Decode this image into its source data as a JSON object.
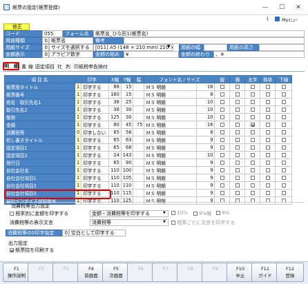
{
  "window": {
    "title": "帳票の設定(帳票登録)",
    "min": "—",
    "max": "☐",
    "close": "✕",
    "menu": "⁞",
    "user": "Myﾒﾆｭｰ"
  },
  "status_badge": "修正",
  "header": {
    "code_label": "コード",
    "code_value": "055",
    "form_label": "フォーム名",
    "form_value": "帳票名_ひな形1(帳票名)",
    "use_label": "用途種類",
    "use_num": "0",
    "use_value": "帳票名",
    "comment_label": "備考",
    "paper_label": "用紙サイズ",
    "paper_num": "0",
    "paper_value": "サイズを選択する",
    "paper_select": "[011] A5 (148 × 210 mm) 210 × 1",
    "width_label": "用紙の幅",
    "height_label": "用紙の高さ",
    "amount_label": "金額表示",
    "amount_num": "0",
    "amount_value": "アラビア数字",
    "amount_start_label": "金額の始め",
    "amount_start_value": "¥",
    "amount_end_label": "金額の終わり",
    "amount_end_value": "、※"
  },
  "tabs": [
    "明　細",
    "書",
    "線",
    "固定項目",
    "社",
    "判",
    "印紙税申告納付"
  ],
  "grid_headers": [
    "項 目 名",
    "印字",
    "X軸",
    "Y軸",
    "幅",
    "フォント名 / サイズ",
    "縦",
    "横",
    "太字",
    "斜体",
    "下線"
  ],
  "rows": [
    {
      "name": "帳票用タイトル",
      "p": "1",
      "pl": "印字する",
      "x": "88",
      "y": "15",
      "w": "",
      "font": "ＭＳ 明朝",
      "size": "16",
      "c": [
        0,
        0,
        0,
        0,
        0
      ]
    },
    {
      "name": "帳票番号",
      "p": "1",
      "pl": "印字する",
      "x": "160",
      "y": "15",
      "w": "",
      "font": "ＭＳ 明朝",
      "size": "8",
      "c": [
        0,
        0,
        0,
        0,
        0
      ]
    },
    {
      "name": "宛名　取引先名1",
      "p": "1",
      "pl": "印字する",
      "x": "38",
      "y": "25",
      "w": "",
      "font": "ＭＳ 明朝",
      "size": "10",
      "c": [
        0,
        0,
        0,
        0,
        0
      ]
    },
    {
      "name": "取引先名2",
      "p": "1",
      "pl": "印字する",
      "x": "38",
      "y": "30",
      "w": "",
      "font": "ＭＳ 明朝",
      "size": "10",
      "c": [
        0,
        0,
        0,
        0,
        0
      ]
    },
    {
      "name": "敬称",
      "p": "1",
      "pl": "印字する",
      "x": "125",
      "y": "30",
      "w": "",
      "font": "ＭＳ 明朝",
      "size": "10",
      "c": [
        0,
        0,
        0,
        0,
        0
      ]
    },
    {
      "name": "金額",
      "p": "1",
      "pl": "印字する",
      "x": "80",
      "y": "45",
      "w": "75",
      "font": "ＭＳ 明朝",
      "size": "16",
      "c": [
        0,
        0,
        1,
        0,
        0
      ]
    },
    {
      "name": "消費税等",
      "p": "0",
      "pl": "印字しない",
      "x": "65",
      "y": "58",
      "w": "",
      "font": "ＭＳ 明朝",
      "size": "8",
      "c": [
        0,
        0,
        0,
        0,
        0
      ]
    },
    {
      "name": "但し書きタイトル",
      "p": "1",
      "pl": "印字する",
      "x": "65",
      "y": "63",
      "w": "",
      "font": "ＭＳ 明朝",
      "size": "9",
      "c": [
        0,
        0,
        0,
        0,
        0
      ]
    },
    {
      "name": "固定項目1",
      "p": "1",
      "pl": "印字する",
      "x": "65",
      "y": "68",
      "w": "",
      "font": "ＭＳ 明朝",
      "size": "9",
      "c": [
        0,
        0,
        0,
        0,
        0
      ]
    },
    {
      "name": "固定項目2",
      "p": "1",
      "pl": "印字する",
      "x": "24",
      "y": "143",
      "w": "",
      "font": "ＭＳ 明朝",
      "size": "10",
      "c": [
        0,
        0,
        0,
        0,
        0
      ]
    },
    {
      "name": "発行日",
      "p": "1",
      "pl": "印字する",
      "x": "65",
      "y": "90",
      "w": "",
      "font": "ＭＳ 明朝",
      "size": "9",
      "c": [
        0,
        0,
        0,
        0,
        0
      ]
    },
    {
      "name": "自社会社名",
      "p": "1",
      "pl": "印字する",
      "x": "110",
      "y": "100",
      "w": "",
      "font": "ＭＳ 明朝",
      "size": "9",
      "c": [
        0,
        0,
        0,
        0,
        0
      ]
    },
    {
      "name": "自社会社項目1",
      "p": "1",
      "pl": "印字する",
      "x": "110",
      "y": "105",
      "w": "",
      "font": "ＭＳ 明朝",
      "size": "9",
      "c": [
        0,
        0,
        0,
        0,
        0
      ]
    },
    {
      "name": "自社会社項目2",
      "p": "1",
      "pl": "印字する",
      "x": "110",
      "y": "110",
      "w": "",
      "font": "ＭＳ 明朝",
      "size": "9",
      "c": [
        0,
        0,
        0,
        0,
        0
      ]
    },
    {
      "name": "自社会社項目3",
      "p": "1",
      "pl": "印字する",
      "x": "110",
      "y": "115",
      "w": "",
      "font": "ＭＳ 明朝",
      "size": "9",
      "c": [
        0,
        0,
        0,
        0,
        0
      ]
    },
    {
      "name": "自社インボイス登録番号",
      "p": "1",
      "pl": "印字する",
      "x": "110",
      "y": "125",
      "w": "",
      "font": "ＭＳ 明朝",
      "size": "9",
      "c": [
        0,
        0,
        0,
        0,
        0
      ]
    }
  ],
  "tax": {
    "title": "消費税等出力設定",
    "opt1": "税率別に金額を印字する",
    "sel1": "金額・消費税等を印字する",
    "r10": "10%",
    "r8": "8%軽",
    "r8b": "8%",
    "disp_label": "消費税等の表示文言",
    "sel2": "消費税等",
    "opt2": "税率ごとに文言を印字する",
    "zero_label": "消費税等の0印字設定",
    "zero_num": "0",
    "zero_value": "空白として印字する"
  },
  "output": {
    "title": "出力設定",
    "opt": "帳票控を印刷する"
  },
  "fkeys": [
    {
      "k": "F1",
      "l": "操作説明",
      "on": true
    },
    {
      "k": "F2",
      "l": "",
      "on": false
    },
    {
      "k": "F3",
      "l": "",
      "on": false
    },
    {
      "k": "F4",
      "l": "前画面",
      "on": true
    },
    {
      "k": "F5",
      "l": "次画面",
      "on": true
    },
    {
      "k": "F6",
      "l": "",
      "on": false
    },
    {
      "k": "F7",
      "l": "",
      "on": false
    },
    {
      "k": "F8",
      "l": "",
      "on": false
    },
    {
      "k": "F9",
      "l": "",
      "on": false
    },
    {
      "k": "F10",
      "l": "中止",
      "on": true
    },
    {
      "k": "F11",
      "l": "ガイド",
      "on": true
    },
    {
      "k": "F12",
      "l": "登録",
      "on": true
    }
  ]
}
